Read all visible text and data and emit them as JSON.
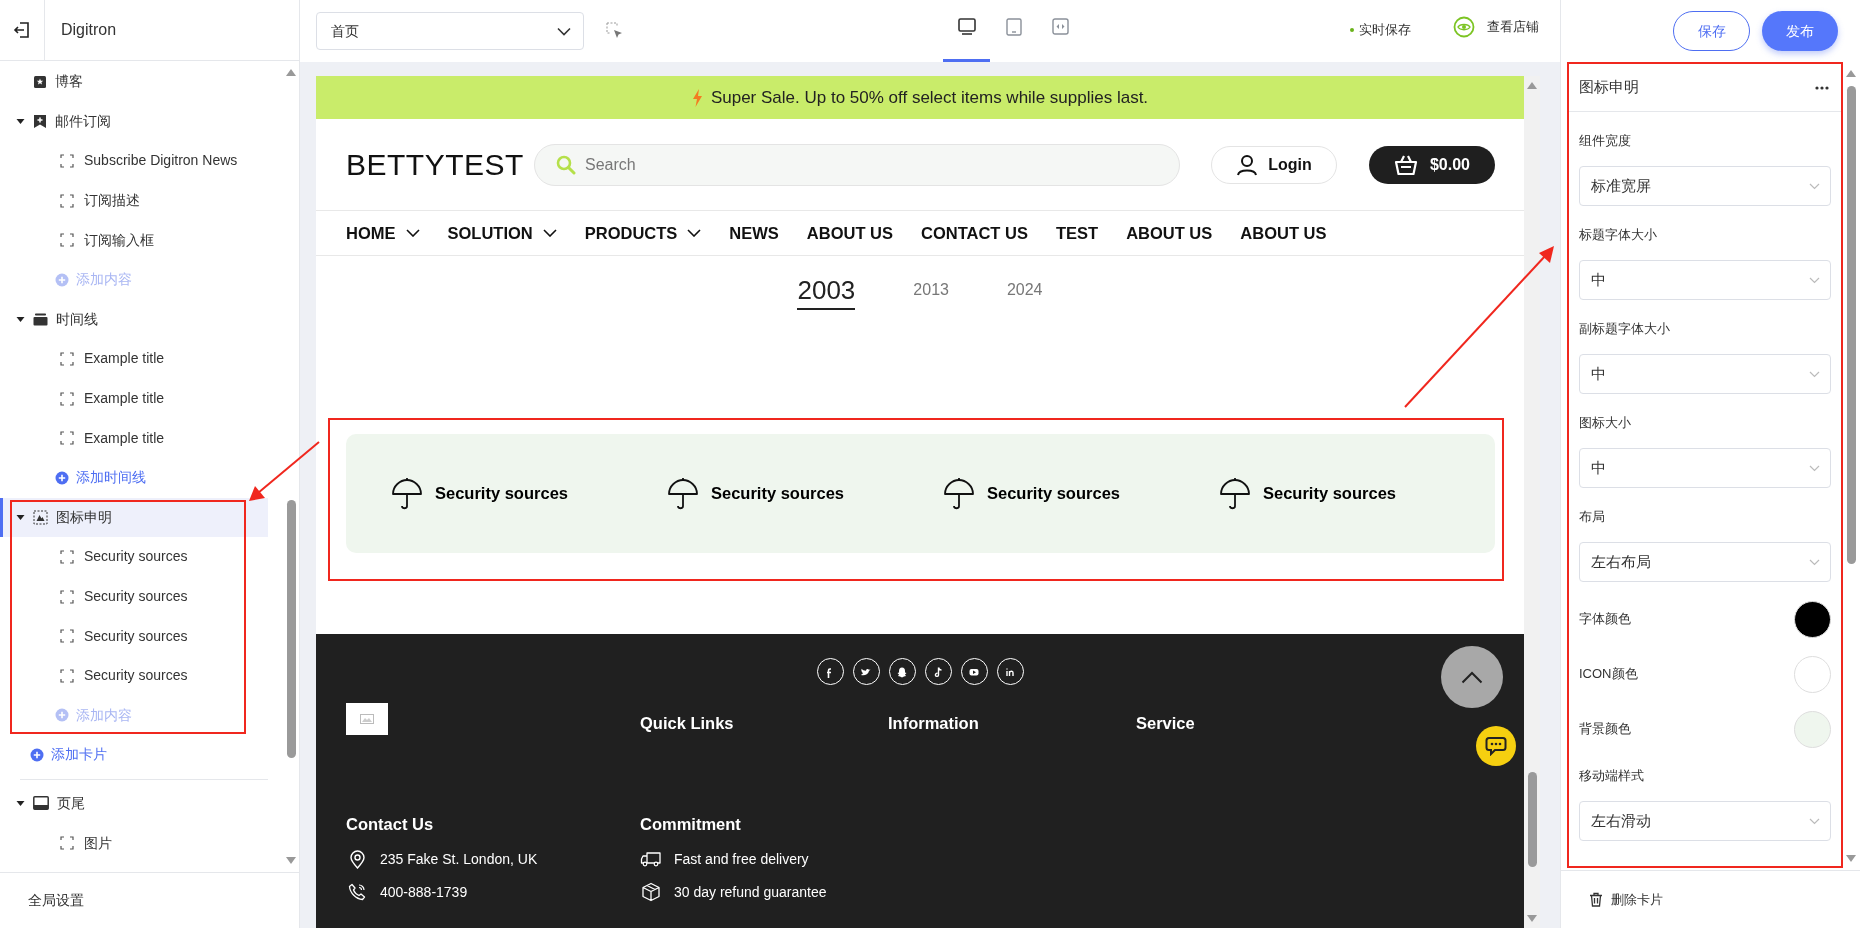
{
  "app": {
    "name": "Digitron"
  },
  "topbar": {
    "page_select": {
      "value": "首页"
    },
    "device_tabs": [
      {
        "kind": "desktop",
        "selected": true
      },
      {
        "kind": "tablet",
        "selected": false
      },
      {
        "kind": "code",
        "selected": false
      }
    ],
    "autosave": "实时保存",
    "view_store": "查看店铺",
    "save_button": "保存",
    "publish_button": "发布"
  },
  "sidebar": {
    "sections": [
      {
        "kind": "blog",
        "label": "博客",
        "selected": false
      },
      {
        "kind": "subscribe",
        "label": "邮件订阅",
        "expanded": true,
        "selected": false,
        "children": [
          {
            "label": "Subscribe Digitron News"
          },
          {
            "label": "订阅描述"
          },
          {
            "label": "订阅输入框"
          }
        ],
        "add_action": {
          "label": "添加内容",
          "disabled": true
        }
      },
      {
        "kind": "timeline",
        "label": "时间线",
        "expanded": true,
        "selected": false,
        "children": [
          {
            "label": "Example title"
          },
          {
            "label": "Example title"
          },
          {
            "label": "Example title"
          }
        ],
        "add_action": {
          "label": "添加时间线",
          "disabled": false
        }
      },
      {
        "kind": "icon_statement",
        "label": "图标申明",
        "expanded": true,
        "selected": true,
        "children": [
          {
            "label": "Security sources"
          },
          {
            "label": "Security sources"
          },
          {
            "label": "Security sources"
          },
          {
            "label": "Security sources"
          }
        ],
        "add_action": {
          "label": "添加内容",
          "disabled": true
        }
      }
    ],
    "add_card": "添加卡片",
    "footer_sections": [
      {
        "kind": "footer",
        "label": "页尾",
        "expanded": true,
        "selected": false,
        "children": [
          {
            "label": "图片"
          }
        ]
      }
    ],
    "global_settings": "全局设置"
  },
  "preview": {
    "announcement": "Super Sale. Up to 50% off select items while supplies last.",
    "logo": "BETTYTEST",
    "search": {
      "placeholder": "Search"
    },
    "login": "Login",
    "cart": "$0.00",
    "nav": [
      {
        "label": "HOME",
        "has_menu": true
      },
      {
        "label": "SOLUTION",
        "has_menu": true
      },
      {
        "label": "PRODUCTS",
        "has_menu": true
      },
      {
        "label": "NEWS",
        "has_menu": false
      },
      {
        "label": "ABOUT US",
        "has_menu": false
      },
      {
        "label": "CONTACT US",
        "has_menu": false
      },
      {
        "label": "TEST",
        "has_menu": false
      },
      {
        "label": "ABOUT US",
        "has_menu": false
      },
      {
        "label": "ABOUT US",
        "has_menu": false
      }
    ],
    "timeline_years": [
      {
        "label": "2003",
        "selected": true
      },
      {
        "label": "2013",
        "selected": false
      },
      {
        "label": "2024",
        "selected": false
      }
    ],
    "features": [
      {
        "title": "Security sources"
      },
      {
        "title": "Security sources"
      },
      {
        "title": "Security sources"
      },
      {
        "title": "Security sources"
      }
    ],
    "footer": {
      "link_headings": [
        "Quick Links",
        "Information",
        "Service"
      ],
      "contact": {
        "heading": "Contact Us",
        "items": [
          {
            "kind": "address",
            "text": "235 Fake St. London, UK"
          },
          {
            "kind": "phone",
            "text": "400-888-1739"
          }
        ]
      },
      "commitment": {
        "heading": "Commitment",
        "items": [
          {
            "kind": "delivery",
            "text": "Fast and free delivery"
          },
          {
            "kind": "refund",
            "text": "30 day refund guarantee"
          }
        ]
      }
    }
  },
  "settings": {
    "title": "图标申明",
    "fields": [
      {
        "kind": "select",
        "label": "组件宽度",
        "value": "标准宽屏"
      },
      {
        "kind": "select",
        "label": "标题字体大小",
        "value": "中"
      },
      {
        "kind": "select",
        "label": "副标题字体大小",
        "value": "中"
      },
      {
        "kind": "select",
        "label": "图标大小",
        "value": "中"
      },
      {
        "kind": "select",
        "label": "布局",
        "value": "左右布局"
      },
      {
        "kind": "color",
        "label": "字体颜色",
        "color": "#000000"
      },
      {
        "kind": "color",
        "label": "ICON颜色",
        "color": "#ffffff"
      },
      {
        "kind": "color",
        "label": "背景颜色",
        "color": "#eff6ee"
      },
      {
        "kind": "select",
        "label": "移动端样式",
        "value": "左右滑动"
      }
    ],
    "delete_card": "删除卡片"
  }
}
